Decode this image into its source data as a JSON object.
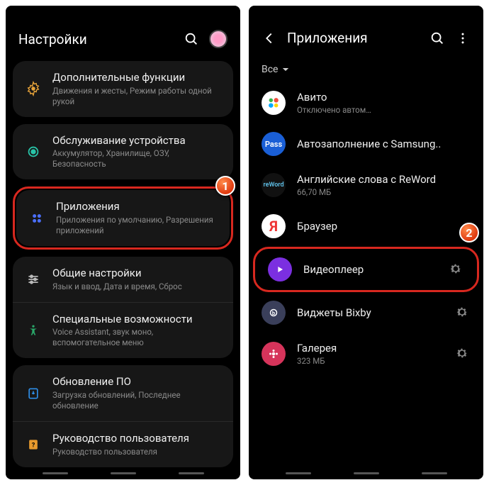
{
  "left": {
    "title": "Настройки",
    "items": [
      {
        "icon": "advanced",
        "title": "Дополнительные функции",
        "sub": "Движения и жесты, Режим работы одной рукой"
      },
      {
        "icon": "care",
        "title": "Обслуживание устройства",
        "sub": "Аккумулятор, Хранилище, ОЗУ, Безопасность"
      },
      {
        "icon": "apps",
        "title": "Приложения",
        "sub": "Приложения по умолчанию, Разрешения приложений"
      },
      {
        "icon": "general",
        "title": "Общие настройки",
        "sub": "Язык и ввод, Дата и время, Сброс"
      },
      {
        "icon": "a11y",
        "title": "Специальные возможности",
        "sub": "Voice Assistant, звук моно, вспомогательное меню"
      },
      {
        "icon": "update",
        "title": "Обновление ПО",
        "sub": "Загрузка обновлений, Последнее обновление"
      },
      {
        "icon": "manual",
        "title": "Руководство пользователя",
        "sub": "Руководство пользователя"
      }
    ],
    "badge": "1"
  },
  "right": {
    "title": "Приложения",
    "filter": "Все",
    "apps": [
      {
        "name": "Авито",
        "sub": "Отключено автом…",
        "icon": "avito",
        "gear": false
      },
      {
        "name": "Автозаполнение с Samsung..",
        "sub": "",
        "icon": "pass",
        "gear": false
      },
      {
        "name": "Английские слова с ReWord",
        "sub": "66,70 МБ",
        "icon": "reword",
        "gear": false
      },
      {
        "name": "Браузер",
        "sub": "",
        "icon": "yandex",
        "gear": false
      },
      {
        "name": "Видеоплеер",
        "sub": "",
        "icon": "video",
        "gear": true,
        "hl": true
      },
      {
        "name": "Виджеты Bixby",
        "sub": "",
        "icon": "bixby",
        "gear": true
      },
      {
        "name": "Галерея",
        "sub": "323 МБ",
        "icon": "gallery",
        "gear": true
      }
    ],
    "badge": "2"
  }
}
